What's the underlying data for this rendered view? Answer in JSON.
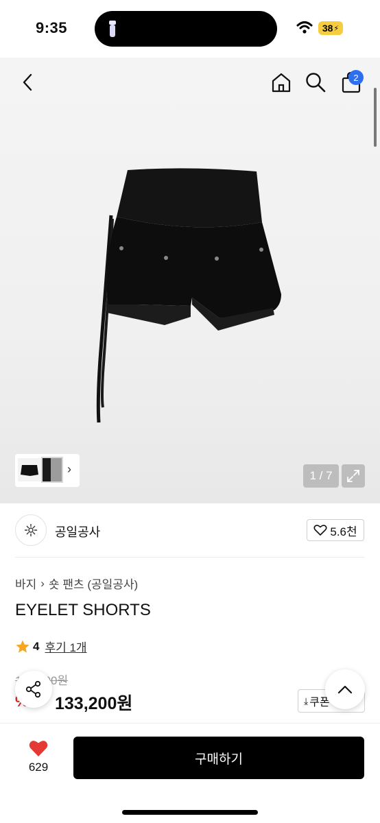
{
  "status_bar": {
    "time": "9:35",
    "battery": "38"
  },
  "header": {
    "back_icon": "chevron-left-icon",
    "home_icon": "home-icon",
    "search_icon": "search-icon",
    "cart_icon": "shopping-bag-icon",
    "cart_count": "2"
  },
  "gallery": {
    "counter": "1 / 7",
    "thumb_arrow": "›",
    "expand_icon": "expand-icon"
  },
  "brand": {
    "name": "공일공사",
    "likes": "5.6천"
  },
  "product": {
    "breadcrumb": [
      "바지",
      "숏 팬츠 (공일공사)"
    ],
    "title": "EYELET SHORTS",
    "rating": "4",
    "reviews": "후기 1개",
    "original_price": "1__,_00원",
    "discount": "%",
    "price": "133,200원",
    "coupon_label": "쿠폰"
  },
  "bottom_bar": {
    "wish_count": "629",
    "buy_label": "구매하기"
  },
  "colors": {
    "accent_badge": "#2e6ff0",
    "star": "#f5a623",
    "heart": "#e53935",
    "discount": "#e02020"
  }
}
